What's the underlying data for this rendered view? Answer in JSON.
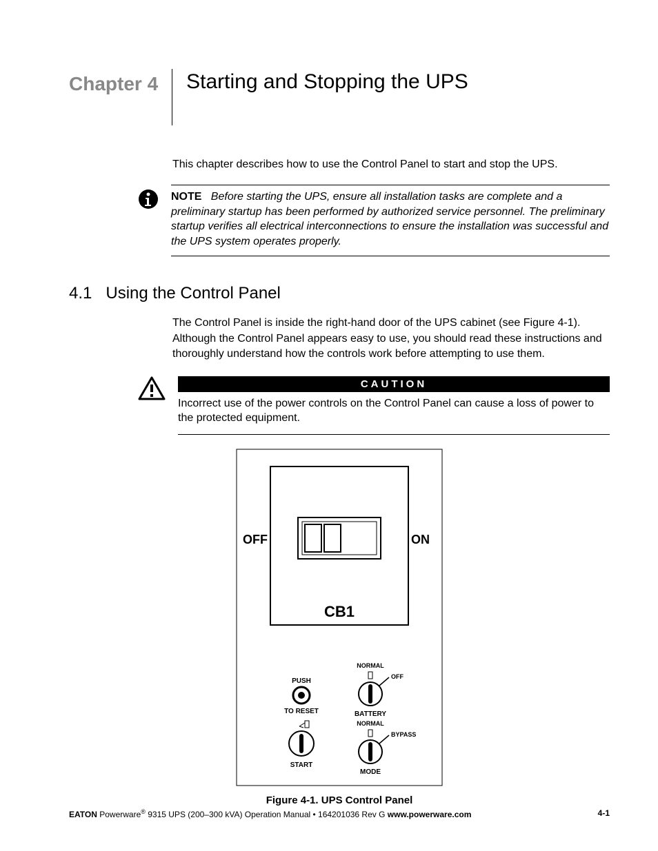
{
  "header": {
    "chapter_label": "Chapter 4",
    "title": "Starting and Stopping the UPS"
  },
  "intro": "This chapter describes how to use the Control Panel to start and stop the UPS.",
  "note": {
    "label": "NOTE",
    "body": "Before starting the UPS, ensure all installation tasks are complete and a preliminary startup has been performed by authorized service personnel. The preliminary startup verifies all electrical interconnections to ensure the installation was successful and the UPS system operates properly."
  },
  "section": {
    "number": "4.1",
    "title": "Using the Control Panel",
    "body": "The Control Panel is inside the right-hand door of the UPS cabinet (see Figure 4-1). Although the Control Panel appears easy to use, you should read these instructions and thoroughly understand how the controls work before attempting to use them."
  },
  "caution": {
    "label": "CAUTION",
    "body": "Incorrect use of the power controls on the Control Panel can cause a loss of power to the protected equipment."
  },
  "figure": {
    "caption": "Figure 4-1. UPS Control Panel",
    "labels": {
      "off": "OFF",
      "on": "ON",
      "cb1": "CB1",
      "push": "PUSH",
      "to_reset": "TO RESET",
      "start": "START",
      "normal1": "NORMAL",
      "off2": "OFF",
      "battery": "BATTERY",
      "normal2": "NORMAL",
      "bypass": "BYPASS",
      "mode": "MODE"
    }
  },
  "footer": {
    "brand": "EATON",
    "product": " Powerware",
    "rest": " 9315 UPS (200–300 kVA) Operation Manual   •   164201036 Rev G   ",
    "url": "www.powerware.com",
    "page": "4-1"
  }
}
